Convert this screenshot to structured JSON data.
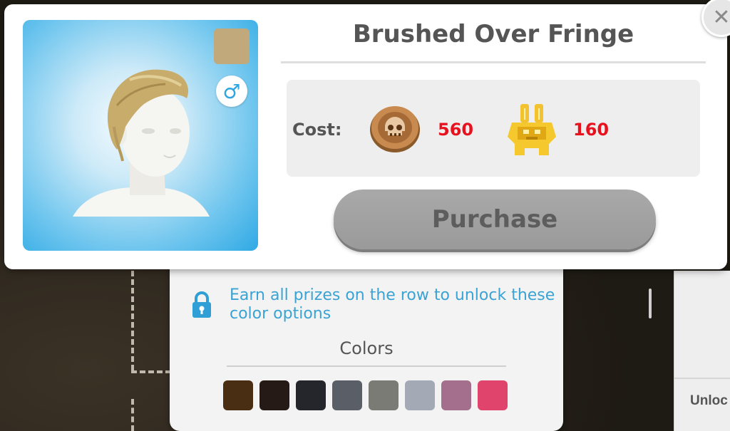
{
  "dialog": {
    "title": "Brushed Over Fringe",
    "close_icon": "close-icon",
    "gender_symbol": "♂",
    "hair_color": "#c1a97b"
  },
  "cost": {
    "label": "Cost:",
    "items": [
      {
        "icon": "skull-coin-icon",
        "amount": "560"
      },
      {
        "icon": "gold-totem-icon",
        "amount": "160"
      }
    ]
  },
  "purchase": {
    "label": "Purchase"
  },
  "colors_panel": {
    "lock_message": "Earn all prizes on the row to unlock these color options",
    "title": "Colors",
    "swatches": [
      "#4a2e14",
      "#251a16",
      "#24262b",
      "#5a5f67",
      "#797b74",
      "#a3a9b5",
      "#a46f8c",
      "#e0446d"
    ]
  },
  "side_panel": {
    "label": "Unloc"
  }
}
